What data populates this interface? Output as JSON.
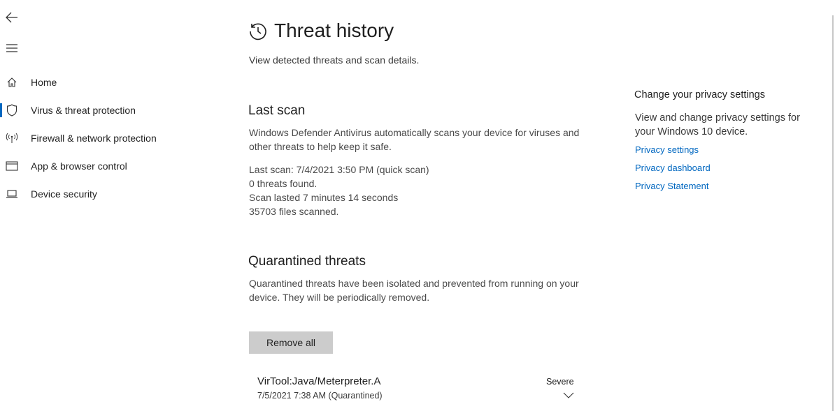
{
  "nav": {
    "back_icon": "back-arrow-icon",
    "menu_icon": "hamburger-menu-icon",
    "items": [
      {
        "label": "Home",
        "icon": "home-icon"
      },
      {
        "label": "Virus & threat protection",
        "icon": "shield-icon"
      },
      {
        "label": "Firewall & network protection",
        "icon": "wireless-antenna-icon"
      },
      {
        "label": "App & browser control",
        "icon": "browser-window-icon"
      },
      {
        "label": "Device security",
        "icon": "laptop-icon"
      }
    ],
    "active_index": 1
  },
  "page": {
    "title": "Threat history",
    "title_icon": "history-clock-icon",
    "subtitle": "View detected threats and scan details."
  },
  "last_scan": {
    "heading": "Last scan",
    "description": "Windows Defender Antivirus automatically scans your device for viruses and other threats to help keep it safe.",
    "line1": "Last scan: 7/4/2021 3:50 PM (quick scan)",
    "line2": "0 threats found.",
    "line3": "Scan lasted 7 minutes 14 seconds",
    "line4": "35703 files scanned."
  },
  "quarantined": {
    "heading": "Quarantined threats",
    "description": "Quarantined threats have been isolated and prevented from running on your device.  They will be periodically removed.",
    "remove_all_label": "Remove all",
    "threats": [
      {
        "name": "VirTool:Java/Meterpreter.A",
        "date": "7/5/2021 7:38 AM (Quarantined)",
        "severity": "Severe"
      }
    ]
  },
  "privacy": {
    "heading": "Change your privacy settings",
    "description": "View and change privacy settings for your Windows 10 device.",
    "links": [
      "Privacy settings",
      "Privacy dashboard",
      "Privacy Statement"
    ]
  },
  "colors": {
    "accent": "#0067c0",
    "button_bg": "#cccccc",
    "text": "#1f1f1f"
  }
}
